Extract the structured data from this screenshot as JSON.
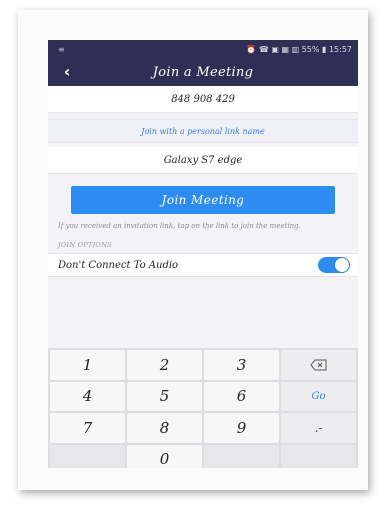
{
  "statusbar": {
    "left": "≡",
    "right": "⏰ ☎ ▣ ▦ ▥ 55% ▮ 15:57"
  },
  "header": {
    "title": "Join a Meeting",
    "back_icon": "chevron-left"
  },
  "meeting_id": {
    "value": "848 908 429"
  },
  "personal_link": {
    "label": "Join with a personal link name"
  },
  "display_name": {
    "value": "Galaxy S7 edge"
  },
  "join_button": {
    "label": "Join Meeting"
  },
  "help_text": "If you received an invitation link, tap on the link to join the meeting.",
  "join_options": {
    "heading": "JOIN OPTIONS",
    "items": [
      {
        "label": "Don't Connect To Audio",
        "enabled": true
      }
    ]
  },
  "keypad": {
    "keys": [
      "1",
      "2",
      "3",
      "backspace",
      "4",
      "5",
      "6",
      "Go",
      "7",
      "8",
      "9",
      ".-",
      "",
      "0",
      "",
      ""
    ]
  },
  "colors": {
    "header_bg": "#2f2f55",
    "accent": "#2d8cf0",
    "link": "#3a7fe0"
  }
}
